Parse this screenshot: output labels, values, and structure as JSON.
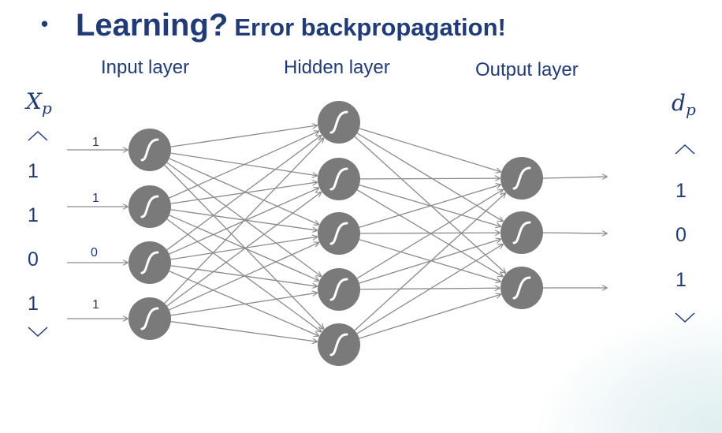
{
  "title": {
    "bullet": "•",
    "main": "Learning?",
    "sub": "Error backpropagation!"
  },
  "layers": {
    "input": "Input layer",
    "hidden": "Hidden layer",
    "output": "Output layer"
  },
  "input_vector": {
    "symbol": "X",
    "subscript": "p",
    "values": [
      "1",
      "1",
      "0",
      "1"
    ],
    "weights": [
      "1",
      "1",
      "0",
      "1"
    ]
  },
  "output_vector": {
    "symbol": "d",
    "subscript": "p",
    "values": [
      "1",
      "0",
      "1"
    ]
  },
  "network": {
    "input_nodes": 4,
    "hidden_nodes": 5,
    "output_nodes": 3,
    "node_color": "#7a7a7a",
    "edge_color": "#8a8a8a",
    "text_color": "#1f3b7a"
  }
}
